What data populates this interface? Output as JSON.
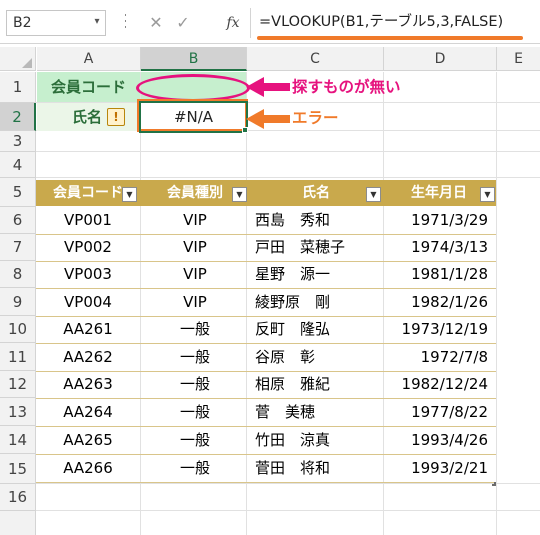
{
  "formula_bar": {
    "name_box": "B2",
    "cancel_icon": "✕",
    "enter_icon": "✓",
    "fx_label": "fx",
    "formula": "=VLOOKUP(B1,テーブル5,3,FALSE)"
  },
  "columns": [
    "A",
    "B",
    "C",
    "D",
    "E"
  ],
  "rows": [
    "1",
    "2",
    "3",
    "4",
    "5",
    "6",
    "7",
    "8",
    "9",
    "10",
    "11",
    "12",
    "13",
    "14",
    "15",
    "16"
  ],
  "cells": {
    "a1": "会員コード",
    "a2": "氏名",
    "b2": "#N/A",
    "error_icon": "!"
  },
  "annotations": {
    "not_found": "探すものが無い",
    "error": "エラー",
    "highlight_color": "#e6127e",
    "accent_color": "#f07a2a"
  },
  "table": {
    "headers": [
      "会員コード",
      "会員種別",
      "氏名",
      "生年月日"
    ],
    "dropdown_icon": "▼",
    "header_color": "#c9a94c",
    "rows": [
      {
        "code": "VP001",
        "type": "VIP",
        "name": "西島　秀和",
        "dob": "1971/3/29"
      },
      {
        "code": "VP002",
        "type": "VIP",
        "name": "戸田　菜穂子",
        "dob": "1974/3/13"
      },
      {
        "code": "VP003",
        "type": "VIP",
        "name": "星野　源一",
        "dob": "1981/1/28"
      },
      {
        "code": "VP004",
        "type": "VIP",
        "name": "綾野原　剛",
        "dob": "1982/1/26"
      },
      {
        "code": "AA261",
        "type": "一般",
        "name": "反町　隆弘",
        "dob": "1973/12/19"
      },
      {
        "code": "AA262",
        "type": "一般",
        "name": "谷原　彰",
        "dob": "1972/7/8"
      },
      {
        "code": "AA263",
        "type": "一般",
        "name": "相原　雅紀",
        "dob": "1982/12/24"
      },
      {
        "code": "AA264",
        "type": "一般",
        "name": "菅　美穂",
        "dob": "1977/8/22"
      },
      {
        "code": "AA265",
        "type": "一般",
        "name": "竹田　涼真",
        "dob": "1993/4/26"
      },
      {
        "code": "AA266",
        "type": "一般",
        "name": "菅田　将和",
        "dob": "1993/2/21"
      }
    ]
  }
}
